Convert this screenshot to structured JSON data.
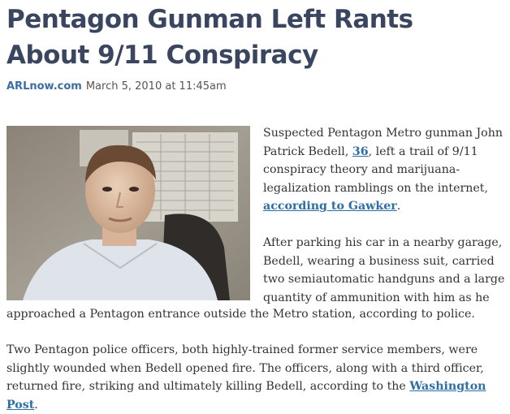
{
  "article": {
    "headline": "Pentagon Gunman Left Rants About 9/11 Conspiracy",
    "site": "ARLnow.com",
    "date": "March 5, 2010 at 11:45am",
    "p1_before": "Suspected Pentagon Metro gunman John Patrick Bedell, ",
    "p1_age_link": "36",
    "p1_middle": ", left a trail of 9/11 conspiracy theory and marijuana-legalization ramblings on the internet, ",
    "p1_link": "according to Gawker",
    "p1_after": ".",
    "p2_top": "After parking his car in a nearby garage, Bedell, wearing a business suit, carried two semiautomatic handguns and a large quantity of ammunition with him as he",
    "p2_bottom": "approached a Pentagon entrance outside the Metro station, according to police.",
    "p3_before": "Two Pentagon police officers, both highly-trained former service members, were slightly wounded when Bedell opened fire. The officers, along with a third officer, returned fire, striking and ultimately killing Bedell, according to the ",
    "p3_link": "Washington Post",
    "p3_after": "."
  },
  "colors": {
    "headline": "#3a4660",
    "link": "#2e6ea6",
    "site": "#3d6da3"
  }
}
